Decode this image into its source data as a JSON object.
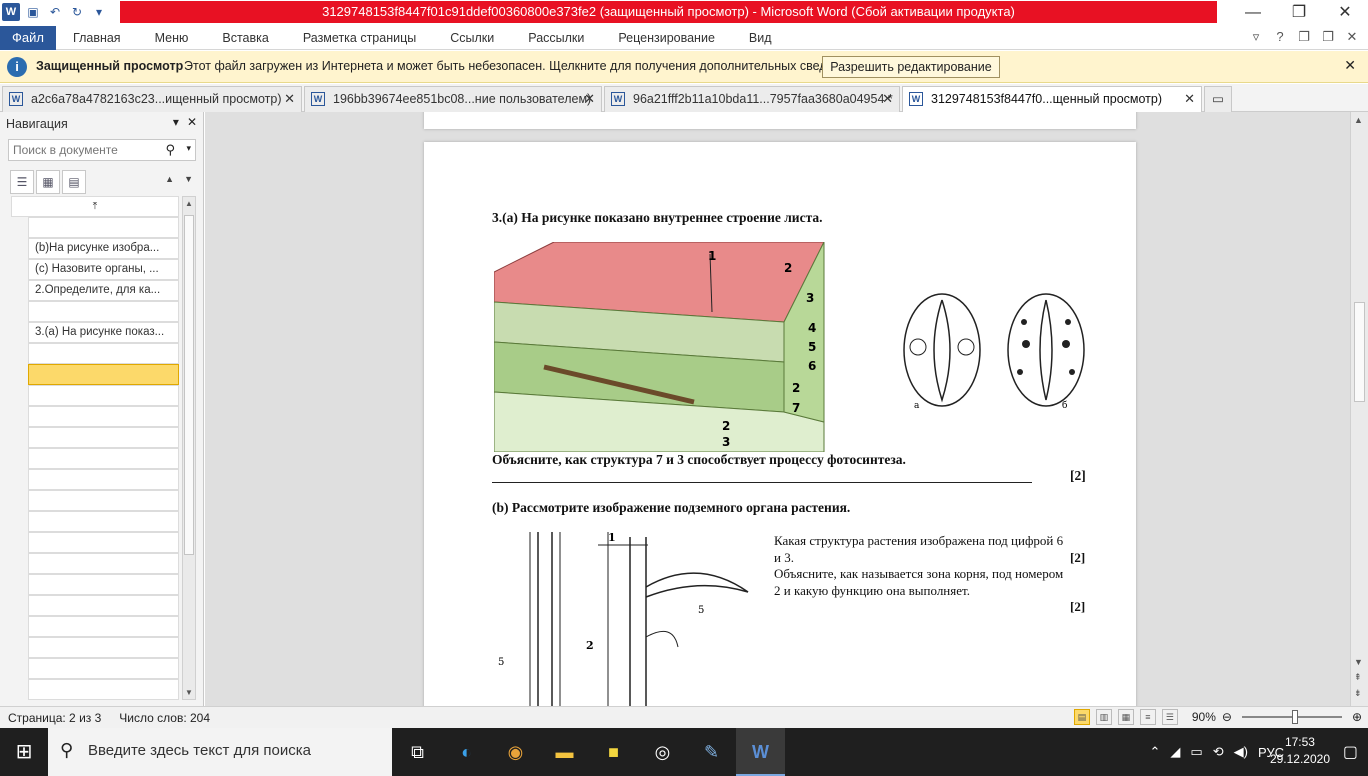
{
  "titlebar": {
    "title": "3129748153f8447f01c91ddef00360800e373fe2 (защищенный просмотр) - Microsoft Word (Сбой активации продукта)",
    "minimize": "—",
    "restore": "❐",
    "close": "✕"
  },
  "ribbon": {
    "file": "Файл",
    "tabs": [
      "Главная",
      "Меню",
      "Вставка",
      "Разметка страницы",
      "Ссылки",
      "Рассылки",
      "Рецензирование",
      "Вид"
    ]
  },
  "protected": {
    "title": "Защищенный просмотр",
    "message": "Этот файл загружен из Интернета и может быть небезопасен. Щелкните для получения дополнительных сведений.",
    "button": "Разрешить редактирование",
    "close": "✕"
  },
  "doctabs": [
    {
      "label": "a2c6a78a4782163c23...ищенный просмотр)"
    },
    {
      "label": "196bb39674ee851bc08...ние пользователем)"
    },
    {
      "label": "96a21fff2b11a10bda11...7957faa3680a04954 *"
    },
    {
      "label": "3129748153f8447f0...щенный просмотр)"
    }
  ],
  "nav": {
    "title": "Навигация",
    "search_placeholder": "Поиск в документе",
    "items": [
      "",
      "(b)На рисунке изобра...",
      "(с) Назовите органы, ...",
      "2.Определите, для ка...",
      "",
      "3.(а) На рисунке показ..."
    ]
  },
  "document": {
    "q3a_title": "3.(а) На рисунке показано внутреннее строение листа.",
    "explain_q": "Объясните, как структура 7 и 3 способствует процессу фотосинтеза.",
    "mark1": "[2]",
    "q3b_title": "(b) Рассмотрите изображение подземного органа растения.",
    "q3b_text1a": "Какая структура растения изображена под цифрой 6",
    "q3b_text1b": "и 3.",
    "mark2": "[2]",
    "q3b_text2a": "Объясните, как называется зона корня, под номером",
    "q3b_text2b": "2 и какую функцию она выполняет.",
    "mark3": "[2]",
    "leaf_labels": [
      "1",
      "2",
      "3",
      "4",
      "5",
      "6",
      "2",
      "7",
      "2",
      "3"
    ],
    "stomata_labels": [
      "а",
      "б"
    ],
    "root_labels": [
      "1",
      "2",
      "5",
      "5"
    ]
  },
  "status": {
    "page": "Страница: 2 из 3",
    "words": "Число слов: 204",
    "zoom": "90%"
  },
  "taskbar": {
    "search_placeholder": "Введите здесь текст для поиска",
    "lang": "РУС",
    "time": "17:53",
    "date": "29.12.2020"
  }
}
